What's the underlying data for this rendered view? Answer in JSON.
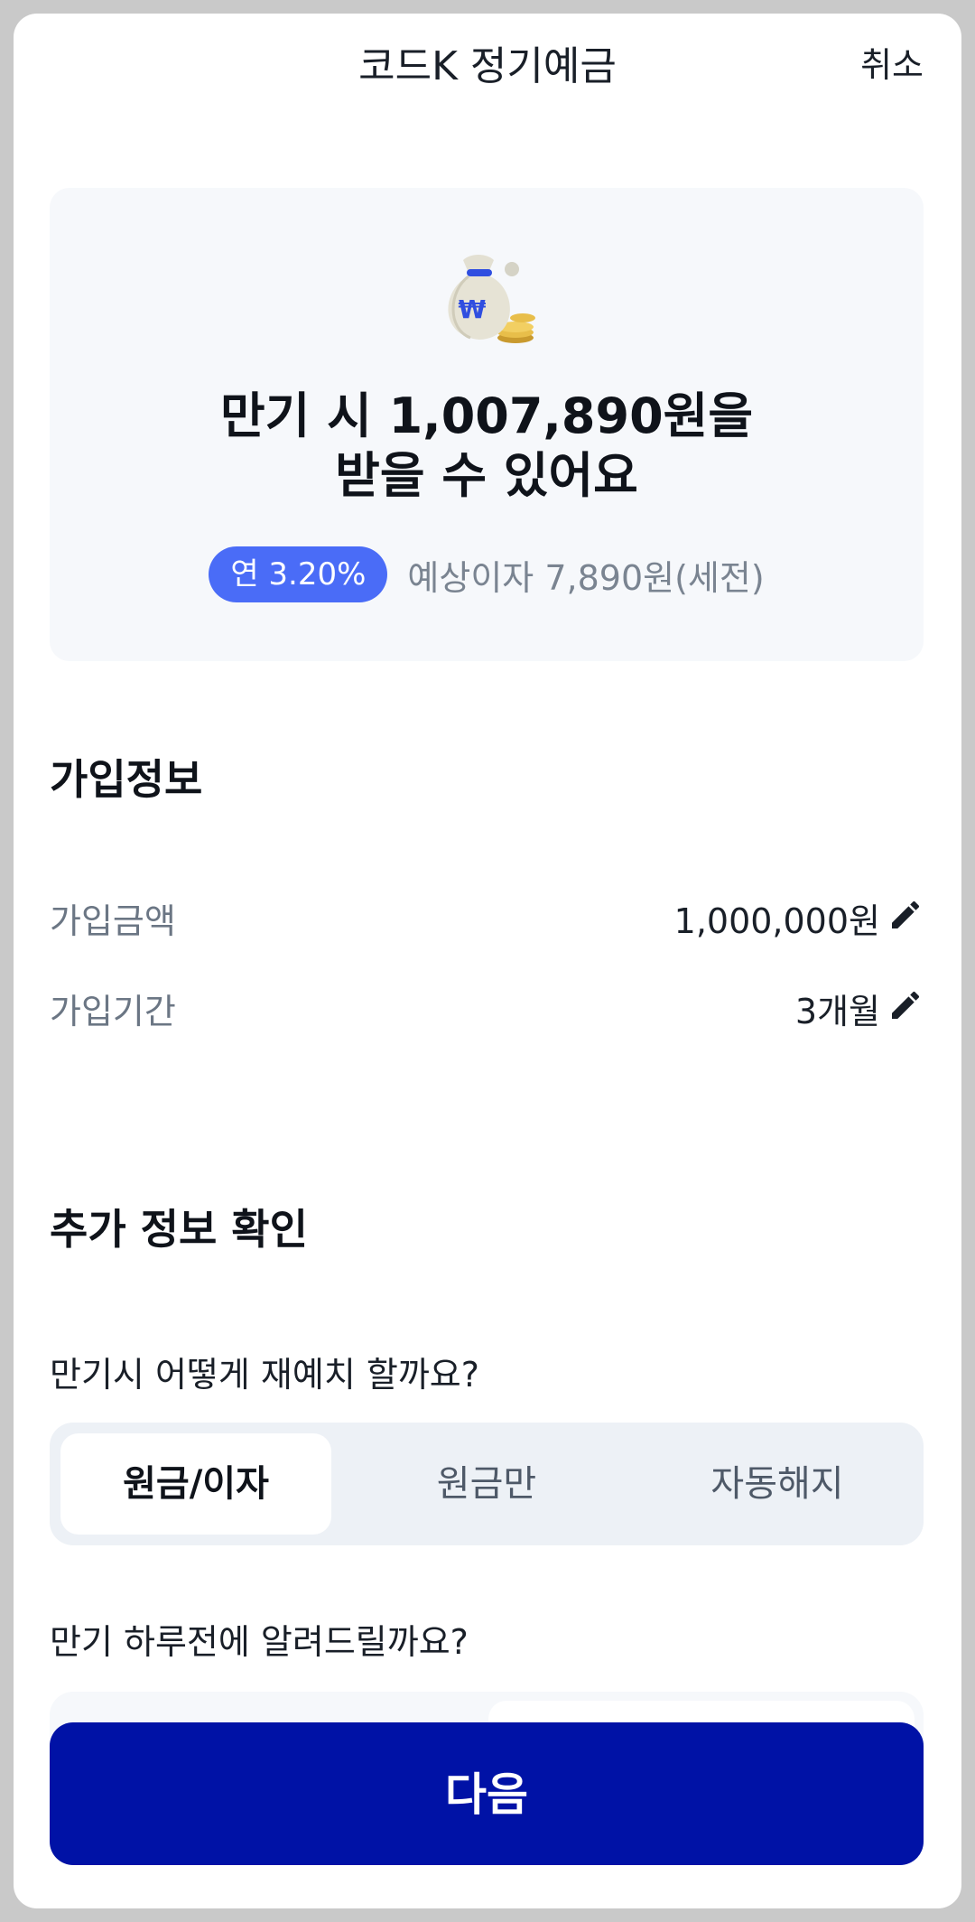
{
  "header": {
    "title": "코드K 정기예금",
    "cancel_label": "취소"
  },
  "summary": {
    "title_line1": "만기 시 1,007,890원을",
    "title_line2": "받을 수 있어요",
    "rate_badge": "연 3.20%",
    "interest_text": "예상이자 7,890원(세전)",
    "bag_symbol": "₩",
    "accent_color": "#4a6cf7"
  },
  "join_info": {
    "heading": "가입정보",
    "rows": [
      {
        "label": "가입금액",
        "value": "1,000,000원"
      },
      {
        "label": "가입기간",
        "value": "3개월"
      }
    ]
  },
  "additional": {
    "heading": "추가 정보 확인",
    "question1": "만기시 어떻게 재예치 할까요?",
    "options": [
      "원금/이자",
      "원금만",
      "자동해지"
    ],
    "selected_option": "원금/이자",
    "question2": "만기 하루전에 알려드릴까요?"
  },
  "footer": {
    "next_label": "다음",
    "button_color": "#0012a6"
  },
  "icons": {
    "edit": "pencil-icon",
    "illustration": "money-bag-icon"
  }
}
